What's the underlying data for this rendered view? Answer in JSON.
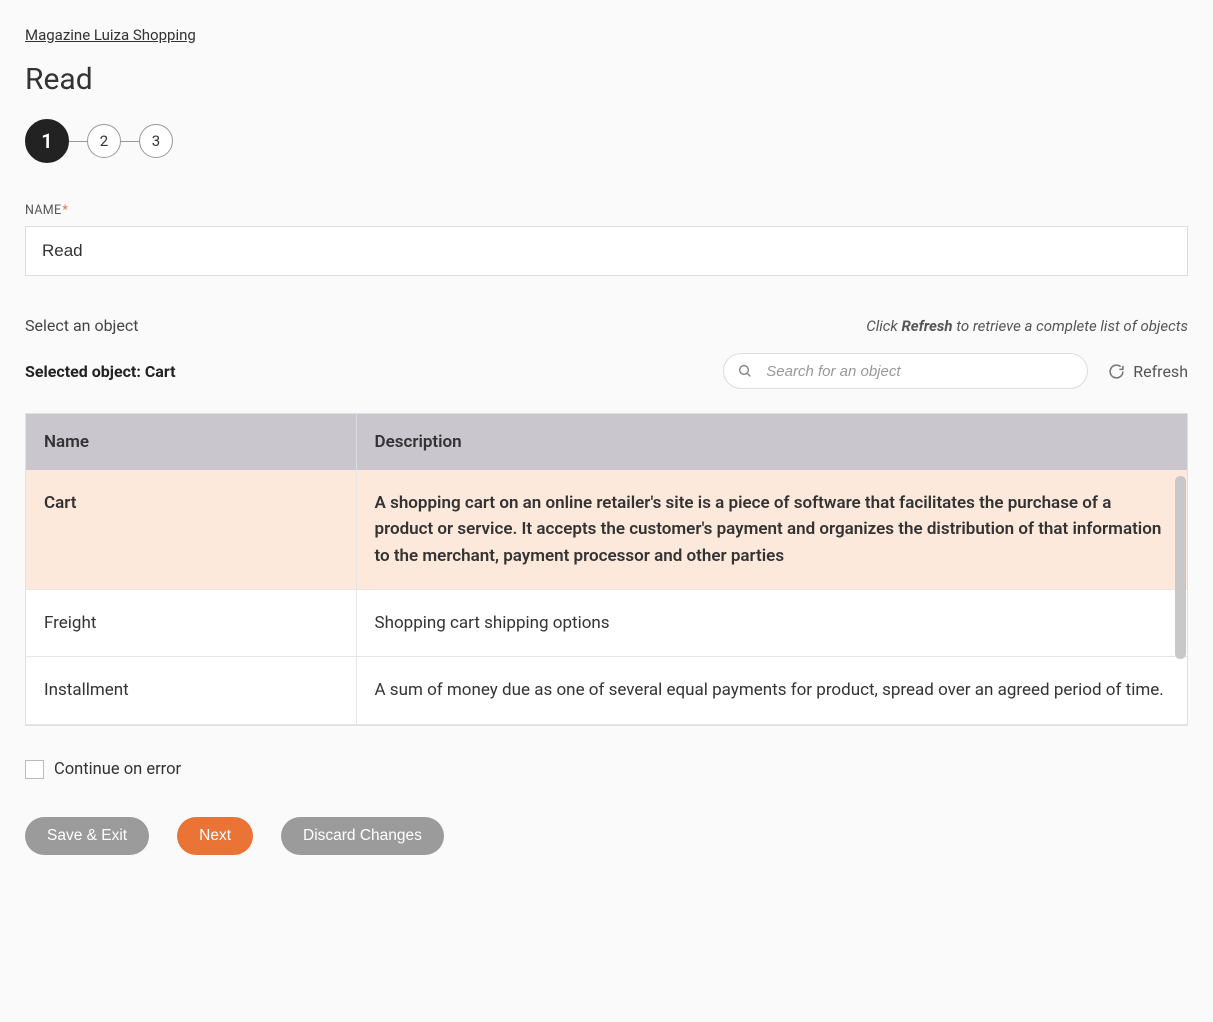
{
  "breadcrumb": "Magazine Luiza Shopping",
  "page_title": "Read",
  "stepper": {
    "steps": [
      "1",
      "2",
      "3"
    ],
    "active_index": 0
  },
  "name_field": {
    "label": "NAME",
    "required_mark": "*",
    "value": "Read"
  },
  "select_section": {
    "prompt": "Select an object",
    "hint_prefix": "Click ",
    "hint_bold": "Refresh",
    "hint_suffix": " to retrieve a complete list of objects",
    "selected_label_prefix": "Selected object: ",
    "selected_value": "Cart",
    "search_placeholder": "Search for an object",
    "refresh_label": "Refresh"
  },
  "table": {
    "headers": {
      "name": "Name",
      "description": "Description"
    },
    "rows": [
      {
        "name": "Cart",
        "description": "A shopping cart on an online retailer's site is a piece of software that facilitates the purchase of a product or service. It accepts the customer's payment and organizes the distribution of that information to the merchant, payment processor and other parties",
        "selected": true
      },
      {
        "name": "Freight",
        "description": "Shopping cart shipping options",
        "selected": false
      },
      {
        "name": "Installment",
        "description": "A sum of money due as one of several equal payments for product, spread over an agreed period of time.",
        "selected": false
      }
    ]
  },
  "continue_on_error_label": "Continue on error",
  "buttons": {
    "save_exit": "Save & Exit",
    "next": "Next",
    "discard": "Discard Changes"
  }
}
